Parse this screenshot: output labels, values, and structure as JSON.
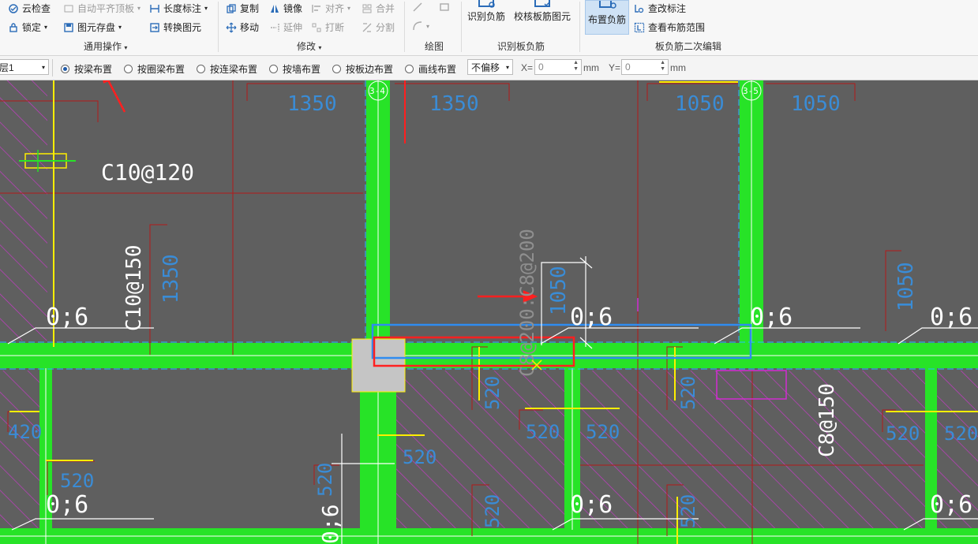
{
  "ribbon": {
    "general": {
      "cloud_check": "云检查",
      "auto_flat_top": "自动平齐顶板",
      "length_mark": "长度标注",
      "lock": "锁定",
      "element_save": "图元存盘",
      "convert_element": "转换图元",
      "group_label": "通用操作"
    },
    "modify": {
      "copy": "复制",
      "mirror": "镜像",
      "align": "对齐",
      "merge": "合并",
      "move": "移动",
      "extend": "延伸",
      "break": "打断",
      "split": "分割",
      "group_label": "修改"
    },
    "draw": {
      "group_label": "绘图"
    },
    "recognize": {
      "identify_neg_rebar": "识别负筋",
      "check_slab_rebar": "校核板筋图元",
      "group_label": "识别板负筋"
    },
    "secondary": {
      "place_neg_rebar": "布置负筋",
      "edit_mark": "查改标注",
      "view_range": "查看布筋范围",
      "group_label": "板负筋二次编辑"
    }
  },
  "options": {
    "layer_select": "层1",
    "radios": [
      {
        "label": "按梁布置",
        "selected": true
      },
      {
        "label": "按圈梁布置",
        "selected": false
      },
      {
        "label": "按连梁布置",
        "selected": false
      },
      {
        "label": "按墙布置",
        "selected": false
      },
      {
        "label": "按板边布置",
        "selected": false
      },
      {
        "label": "画线布置",
        "selected": false
      }
    ],
    "offset_select": "不偏移",
    "x_label": "X=",
    "x_value": "0",
    "y_label": "Y=",
    "y_value": "0",
    "unit": "mm"
  },
  "drawing": {
    "labels": {
      "dim_1350_a": "1350",
      "dim_1350_b": "1350",
      "dim_1050_a": "1050",
      "dim_1050_b": "1050",
      "axis_3_4": "3-4",
      "axis_3_5": "3-5",
      "rebar_c10_120": "C10@120",
      "rebar_c10_150": "C10@150",
      "dim_1350_v": "1350",
      "rebar_ghost": "C8@200:C8@200",
      "dim_1050_v": "1050",
      "dim_1050_v_right": "1050",
      "rebar_c8_150": "C8@150",
      "coord_06": "0;6",
      "dim_520": "520",
      "dim_420": "420"
    }
  }
}
